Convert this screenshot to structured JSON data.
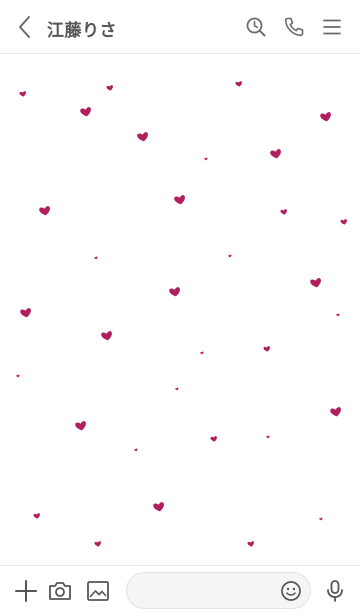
{
  "header": {
    "title": "江藤りさ",
    "icons": [
      "back-icon",
      "search-history-icon",
      "phone-icon",
      "menu-icon"
    ]
  },
  "theme": {
    "heart_color": "#b0205e",
    "icon_color": "#6b6b6b",
    "background": "#ffffff"
  },
  "input_bar": {
    "icons": [
      "plus-icon",
      "camera-icon",
      "image-icon",
      "emoji-icon",
      "microphone-icon"
    ],
    "message_placeholder": ""
  }
}
